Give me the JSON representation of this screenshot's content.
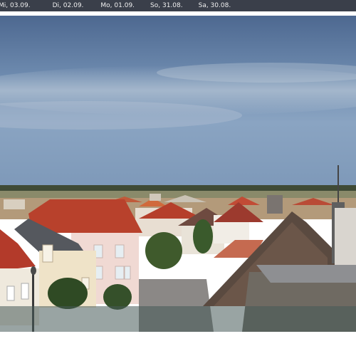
{
  "date_tabs": [
    {
      "label": "Mi, 03.09."
    },
    {
      "label": "Di, 02.09."
    },
    {
      "label": "Mo, 01.09."
    },
    {
      "label": "So, 31.08."
    },
    {
      "label": "Sa, 30.08."
    }
  ],
  "colors": {
    "date_bar_bg": "#3a3f4a",
    "sky_top": "#4f6a92",
    "sky_bottom": "#86a3c4",
    "roof_red": "#b8412c",
    "overlay": "#465a58"
  }
}
